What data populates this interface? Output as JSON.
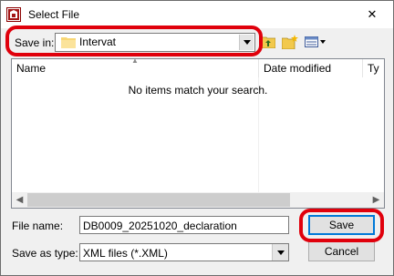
{
  "window": {
    "title": "Select File",
    "close_glyph": "✕"
  },
  "toolbar": {
    "save_in_label": "Save in:",
    "save_in_value": "Intervat",
    "buttons": [
      "up-folder-icon",
      "new-folder-icon",
      "view-menu-icon"
    ]
  },
  "list": {
    "columns": [
      "Name",
      "Date modified",
      "Ty"
    ],
    "empty_message": "No items match your search."
  },
  "form": {
    "file_name_label": "File name:",
    "file_name_value": "DB0009_20251020_declaration",
    "save_as_type_label": "Save as type:",
    "save_as_type_value": "XML files (*.XML)"
  },
  "buttons": {
    "save": "Save",
    "cancel": "Cancel"
  },
  "highlight_color": "#e0000c",
  "accent_color": "#0078d7"
}
